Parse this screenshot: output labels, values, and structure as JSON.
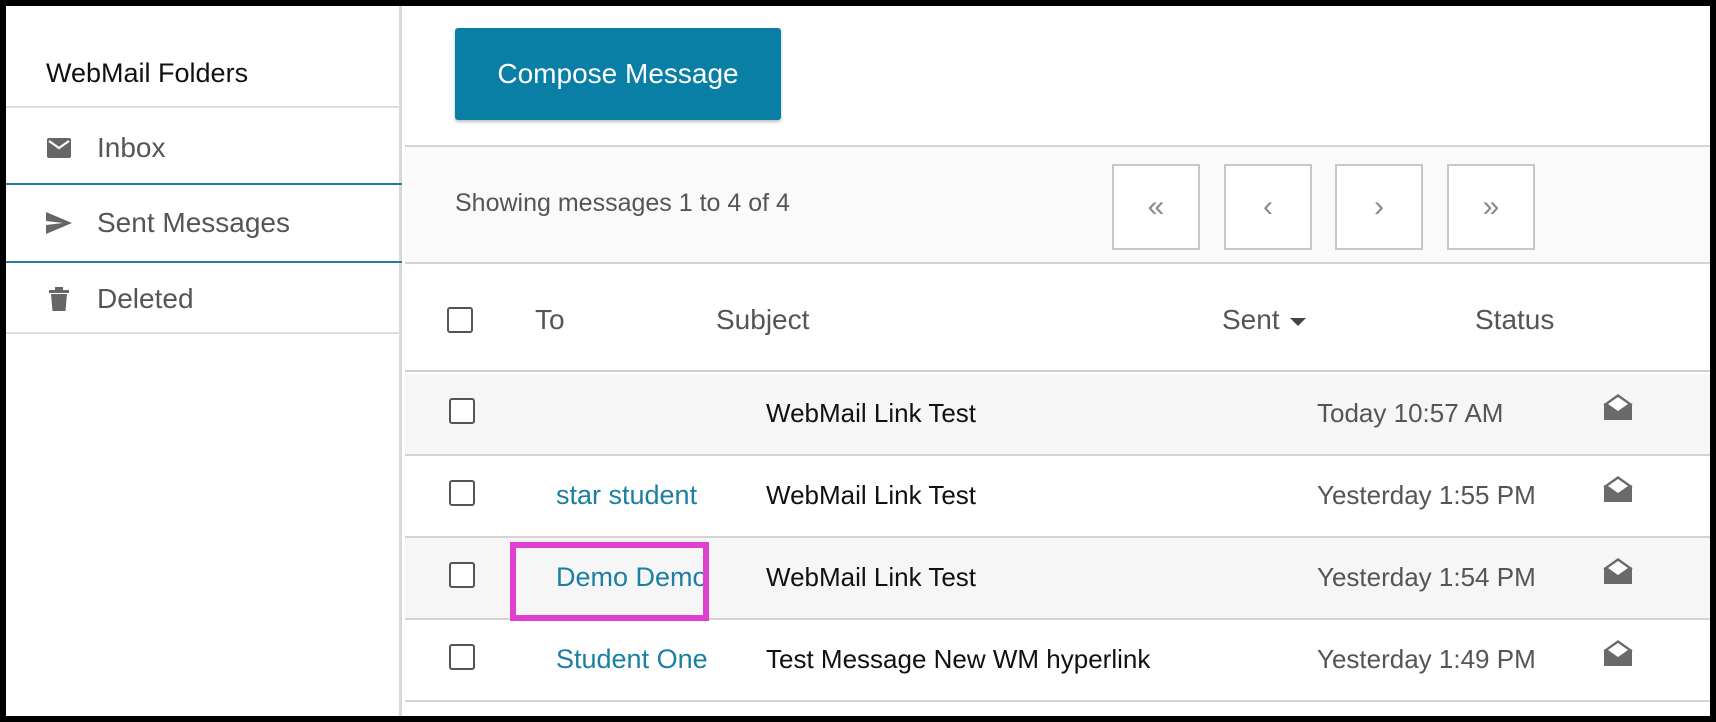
{
  "sidebar": {
    "title": "WebMail Folders",
    "items": [
      {
        "label": "Inbox",
        "icon": "envelope-icon"
      },
      {
        "label": "Sent Messages",
        "icon": "send-icon",
        "active": true
      },
      {
        "label": "Deleted",
        "icon": "trash-icon"
      }
    ]
  },
  "toolbar": {
    "compose_label": "Compose Message"
  },
  "pager": {
    "text": "Showing messages 1 to 4 of 4",
    "first": "«",
    "prev": "‹",
    "next": "›",
    "last": "»"
  },
  "table": {
    "headers": {
      "to": "To",
      "subject": "Subject",
      "sent": "Sent",
      "status": "Status"
    },
    "rows": [
      {
        "to": "",
        "subject": "WebMail Link Test",
        "sent": "Today 10:57 AM",
        "status": "read-envelope-icon"
      },
      {
        "to": "star student",
        "subject": "WebMail Link Test",
        "sent": "Yesterday 1:55 PM",
        "status": "read-envelope-icon"
      },
      {
        "to": "Demo Demo",
        "subject": "WebMail Link Test",
        "sent": "Yesterday 1:54 PM",
        "status": "read-envelope-icon"
      },
      {
        "to": "Student One",
        "subject": "Test Message New WM hyperlink",
        "sent": "Yesterday 1:49 PM",
        "status": "read-envelope-icon"
      }
    ]
  },
  "colors": {
    "accent": "#0a7fa6",
    "link": "#1a7fa3",
    "highlight": "#e040d0"
  }
}
